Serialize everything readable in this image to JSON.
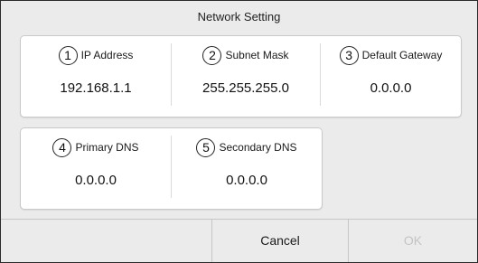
{
  "dialog": {
    "title": "Network Setting",
    "fields": [
      {
        "number": "1",
        "label": "IP Address",
        "value": "192.168.1.1"
      },
      {
        "number": "2",
        "label": "Subnet Mask",
        "value": "255.255.255.0"
      },
      {
        "number": "3",
        "label": "Default Gateway",
        "value": "0.0.0.0"
      },
      {
        "number": "4",
        "label": "Primary DNS",
        "value": "0.0.0.0"
      },
      {
        "number": "5",
        "label": "Secondary DNS",
        "value": "0.0.0.0"
      }
    ],
    "buttons": {
      "cancel": "Cancel",
      "ok": "OK"
    }
  }
}
